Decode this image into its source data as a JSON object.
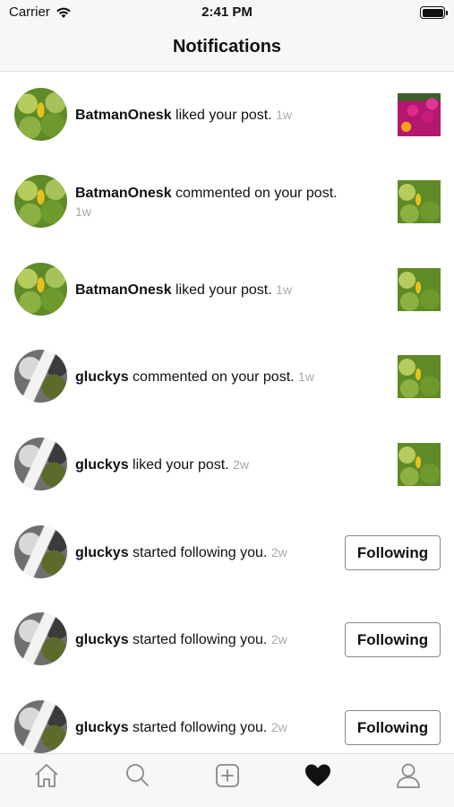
{
  "status_bar": {
    "carrier": "Carrier",
    "time": "2:41 PM"
  },
  "nav": {
    "title": "Notifications"
  },
  "notifications": [
    {
      "username": "BatmanOnesk",
      "action": "liked your post.",
      "time": "1w"
    },
    {
      "username": "BatmanOnesk",
      "action": "commented on your post.",
      "time": "1w"
    },
    {
      "username": "BatmanOnesk",
      "action": "liked your post.",
      "time": "1w"
    },
    {
      "username": "gluckys",
      "action": "commented on your post.",
      "time": "1w"
    },
    {
      "username": "gluckys",
      "action": "liked your post.",
      "time": "2w"
    },
    {
      "username": "gluckys",
      "action": "started following you.",
      "time": "2w",
      "button": "Following"
    },
    {
      "username": "gluckys",
      "action": "started following you.",
      "time": "2w",
      "button": "Following"
    },
    {
      "username": "gluckys",
      "action": "started following you.",
      "time": "2w",
      "button": "Following"
    }
  ],
  "tab_bar": {
    "items": [
      {
        "icon": "home-icon"
      },
      {
        "icon": "search-icon"
      },
      {
        "icon": "add-post-icon"
      },
      {
        "icon": "heart-icon",
        "active": true
      },
      {
        "icon": "profile-icon"
      }
    ]
  }
}
